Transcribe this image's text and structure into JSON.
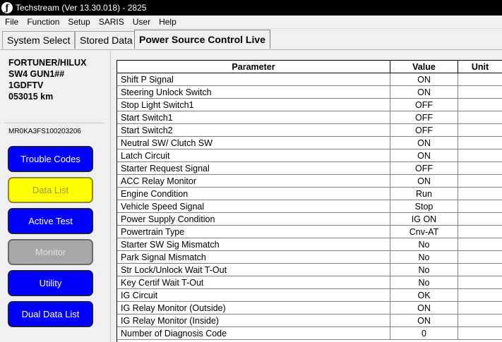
{
  "window": {
    "title": "Techstream (Ver 13.30.018) - 2825"
  },
  "menu": [
    "File",
    "Function",
    "Setup",
    "SARIS",
    "User",
    "Help"
  ],
  "tabs": [
    {
      "label": "System Select",
      "active": false
    },
    {
      "label": "Stored Data",
      "active": false
    },
    {
      "label": "Power Source Control Live",
      "active": true
    }
  ],
  "vehicle": {
    "model_line1": "FORTUNER/HILUX",
    "model_line2": "SW4 GUN1##",
    "engine": "1GDFTV",
    "odometer": "053015 km",
    "vin": "MR0KA3FS100203206"
  },
  "nav_buttons": [
    {
      "label": "Trouble Codes",
      "state": "enabled",
      "color": "#0000ff"
    },
    {
      "label": "Data List",
      "state": "selected",
      "color": "#ffff00"
    },
    {
      "label": "Active Test",
      "state": "enabled",
      "color": "#0000ff"
    },
    {
      "label": "Monitor",
      "state": "disabled",
      "color": "#a8a8a8"
    },
    {
      "label": "Utility",
      "state": "enabled",
      "color": "#0000ff"
    },
    {
      "label": "Dual Data List",
      "state": "enabled",
      "color": "#0000ff"
    }
  ],
  "table": {
    "columns": [
      "Parameter",
      "Value",
      "Unit"
    ],
    "rows": [
      {
        "parameter": "Shift P Signal",
        "value": "ON",
        "unit": ""
      },
      {
        "parameter": "Steering Unlock Switch",
        "value": "ON",
        "unit": ""
      },
      {
        "parameter": "Stop Light Switch1",
        "value": "OFF",
        "unit": ""
      },
      {
        "parameter": "Start Switch1",
        "value": "OFF",
        "unit": ""
      },
      {
        "parameter": "Start Switch2",
        "value": "OFF",
        "unit": ""
      },
      {
        "parameter": "Neutral SW/ Clutch SW",
        "value": "ON",
        "unit": ""
      },
      {
        "parameter": "Latch Circuit",
        "value": "ON",
        "unit": ""
      },
      {
        "parameter": "Starter Request Signal",
        "value": "OFF",
        "unit": ""
      },
      {
        "parameter": "ACC Relay Monitor",
        "value": "ON",
        "unit": ""
      },
      {
        "parameter": "Engine Condition",
        "value": "Run",
        "unit": ""
      },
      {
        "parameter": "Vehicle Speed Signal",
        "value": "Stop",
        "unit": ""
      },
      {
        "parameter": "Power Supply Condition",
        "value": "IG ON",
        "unit": ""
      },
      {
        "parameter": "Powertrain Type",
        "value": "Cnv-AT",
        "unit": ""
      },
      {
        "parameter": "Starter SW Sig Mismatch",
        "value": "No",
        "unit": ""
      },
      {
        "parameter": "Park Signal Mismatch",
        "value": "No",
        "unit": ""
      },
      {
        "parameter": "Str Lock/Unlock Wait T-Out",
        "value": "No",
        "unit": ""
      },
      {
        "parameter": "Key Certif Wait T-Out",
        "value": "No",
        "unit": ""
      },
      {
        "parameter": "IG Circuit",
        "value": "OK",
        "unit": ""
      },
      {
        "parameter": "IG Relay Monitor (Outside)",
        "value": "ON",
        "unit": ""
      },
      {
        "parameter": "IG Relay Monitor (Inside)",
        "value": "ON",
        "unit": ""
      },
      {
        "parameter": "Number of Diagnosis Code",
        "value": "0",
        "unit": ""
      }
    ]
  }
}
